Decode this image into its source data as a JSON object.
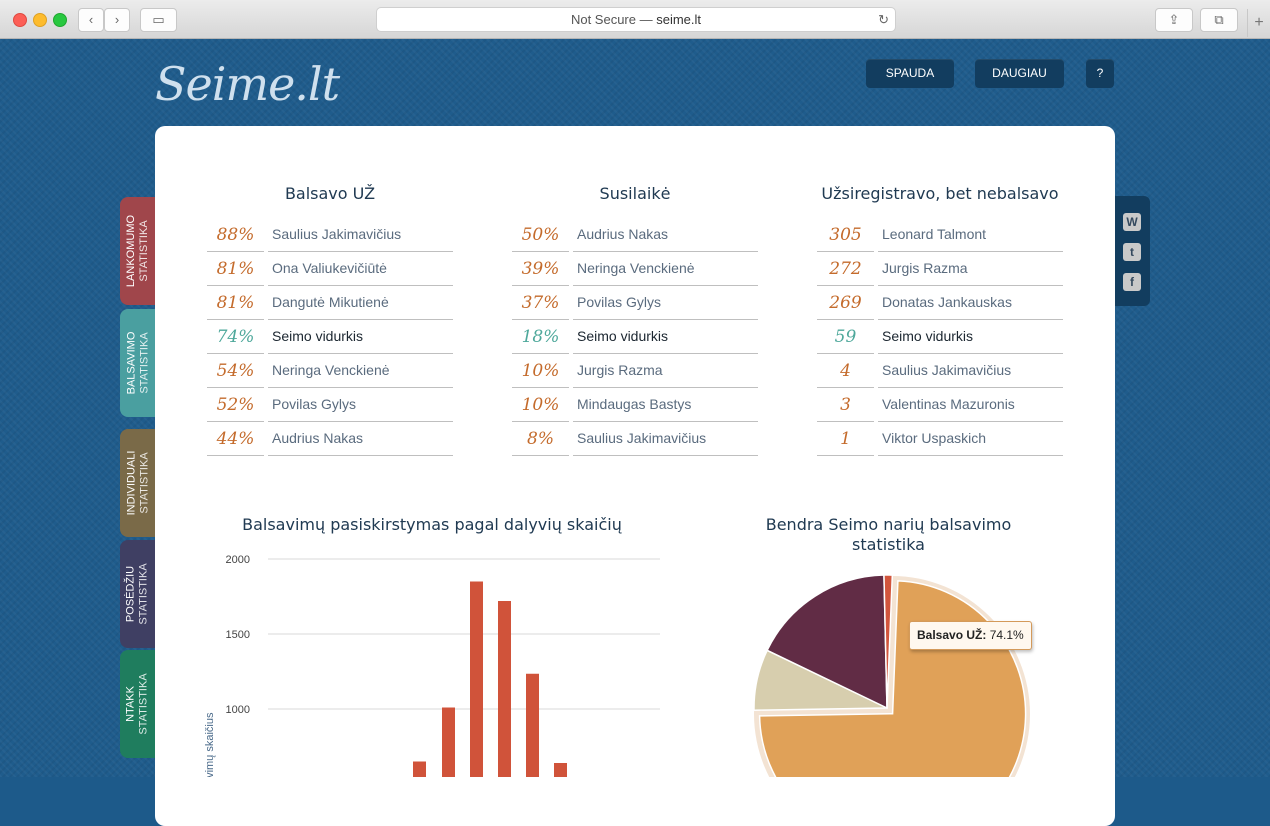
{
  "browser": {
    "url_prefix": "Not Secure —",
    "url_host": "seime.lt"
  },
  "header": {
    "logo": "Seime.lt",
    "nav": [
      "SPAUDA",
      "DAUGIAU",
      "?"
    ]
  },
  "sidetabs": [
    {
      "line1": "LANKOMUMO",
      "line2": "STATISTIKA",
      "color": "#a0464b"
    },
    {
      "line1": "BALSAVIMO",
      "line2": "STATISTIKA",
      "color": "#4a9fa0"
    },
    {
      "line1": "INDIVIDUALI",
      "line2": "STATISTIKA",
      "color": "#7a6a48"
    },
    {
      "line1": "POSĖDŽIU",
      "line2": "STATISTIKA",
      "color": "#3f3f63"
    },
    {
      "line1": "NTAKK",
      "line2": "STATISTIKA",
      "color": "#1f7d5e"
    }
  ],
  "social_icons": [
    "wordpress-icon",
    "twitter-icon",
    "facebook-icon"
  ],
  "tables": [
    {
      "title": "Balsavo UŽ",
      "rows": [
        {
          "value": "88%",
          "name": "Saulius Jakimavičius"
        },
        {
          "value": "81%",
          "name": "Ona Valiukevičiūtė"
        },
        {
          "value": "81%",
          "name": "Dangutė Mikutienė"
        },
        {
          "value": "74%",
          "name": "Seimo vidurkis",
          "avg": true
        },
        {
          "value": "54%",
          "name": "Neringa Venckienė"
        },
        {
          "value": "52%",
          "name": "Povilas Gylys"
        },
        {
          "value": "44%",
          "name": "Audrius Nakas"
        }
      ]
    },
    {
      "title": "Susilaikė",
      "rows": [
        {
          "value": "50%",
          "name": "Audrius Nakas"
        },
        {
          "value": "39%",
          "name": "Neringa Venckienė"
        },
        {
          "value": "37%",
          "name": "Povilas Gylys"
        },
        {
          "value": "18%",
          "name": "Seimo vidurkis",
          "avg": true
        },
        {
          "value": "10%",
          "name": "Jurgis Razma"
        },
        {
          "value": "10%",
          "name": "Mindaugas Bastys"
        },
        {
          "value": "8%",
          "name": "Saulius Jakimavičius"
        }
      ]
    },
    {
      "title": "Užsiregistravo, bet nebalsavo",
      "rows": [
        {
          "value": "305",
          "name": "Leonard Talmont"
        },
        {
          "value": "272",
          "name": "Jurgis Razma"
        },
        {
          "value": "269",
          "name": "Donatas Jankauskas"
        },
        {
          "value": "59",
          "name": "Seimo vidurkis",
          "avg": true
        },
        {
          "value": "4",
          "name": "Saulius Jakimavičius"
        },
        {
          "value": "3",
          "name": "Valentinas Mazuronis"
        },
        {
          "value": "1",
          "name": "Viktor Uspaskich"
        }
      ]
    }
  ],
  "chart_data": [
    {
      "type": "bar",
      "title": "Balsavimų pasiskirstymas pagal dalyvių skaičių",
      "ylabel": "Balsavimų skaičius",
      "ylim": [
        0,
        2000
      ],
      "yticks": [
        1000,
        1500,
        2000
      ],
      "grid": true,
      "color": "#d0533a",
      "values": [
        650,
        1010,
        1850,
        1720,
        1235,
        640
      ]
    },
    {
      "type": "pie",
      "title": "Bendra Seimo narių balsavimo statistika",
      "slices": [
        {
          "label": "Balsavo UŽ",
          "value": 74.1,
          "color": "#e0a158"
        },
        {
          "label": "",
          "value": 7.4,
          "color": "#d7ceae"
        },
        {
          "label": "",
          "value": 17.5,
          "color": "#612c45"
        },
        {
          "label": "",
          "value": 1.0,
          "color": "#d2553c"
        }
      ],
      "tooltip": {
        "label": "Balsavo UŽ:",
        "value": "74.1%"
      }
    }
  ]
}
